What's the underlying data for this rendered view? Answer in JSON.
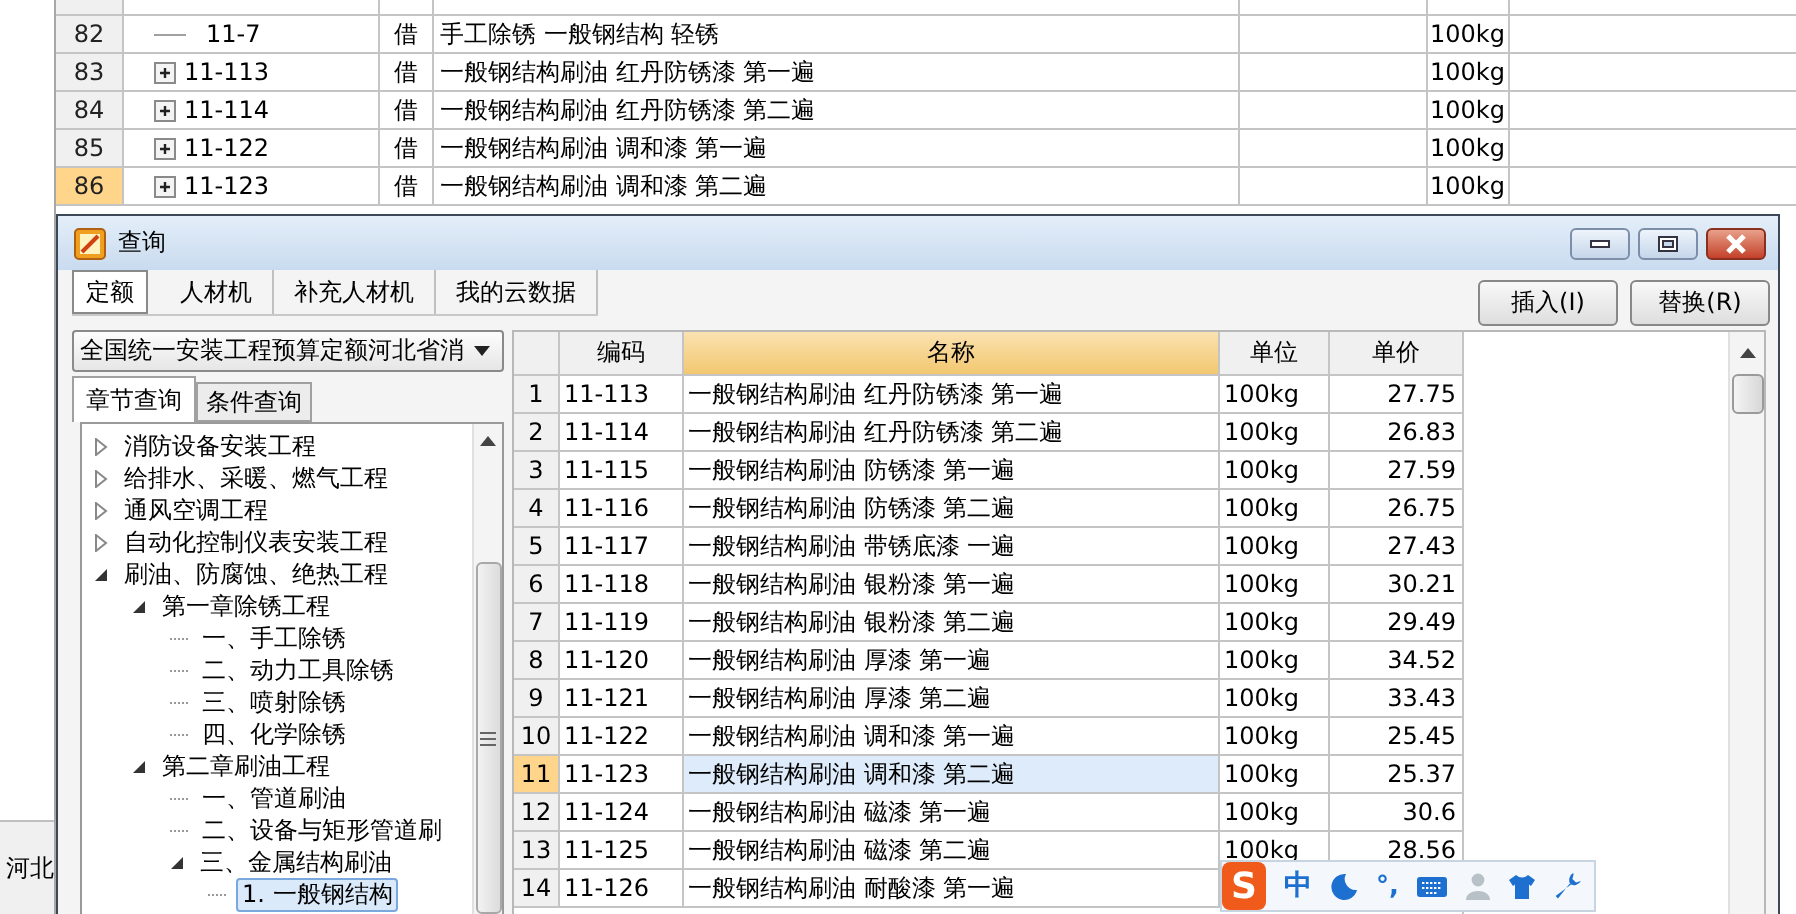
{
  "sheet": {
    "rows": [
      {
        "number": "82",
        "expandable": false,
        "code": "11-7",
        "type": "借",
        "name": "手工除锈 一般钢结构 轻锈",
        "unit": "100kg",
        "selected": false
      },
      {
        "number": "83",
        "expandable": true,
        "code": "11-113",
        "type": "借",
        "name": "一般钢结构刷油 红丹防锈漆 第一遍",
        "unit": "100kg",
        "selected": false
      },
      {
        "number": "84",
        "expandable": true,
        "code": "11-114",
        "type": "借",
        "name": "一般钢结构刷油 红丹防锈漆 第二遍",
        "unit": "100kg",
        "selected": false
      },
      {
        "number": "85",
        "expandable": true,
        "code": "11-122",
        "type": "借",
        "name": "一般钢结构刷油 调和漆 第一遍",
        "unit": "100kg",
        "selected": false
      },
      {
        "number": "86",
        "expandable": true,
        "code": "11-123",
        "type": "借",
        "name": "一般钢结构刷油 调和漆 第二遍",
        "unit": "100kg",
        "selected": true
      }
    ]
  },
  "side_panel": {
    "text": "河北"
  },
  "dialog": {
    "title": "查询",
    "tabs": [
      {
        "label": "定额",
        "selected": true
      },
      {
        "label": "人材机",
        "selected": false
      },
      {
        "label": "补充人材机",
        "selected": false
      },
      {
        "label": "我的云数据",
        "selected": false
      }
    ],
    "buttons": [
      "插入(I)",
      "替换(R)"
    ],
    "library": "全国统一安装工程预算定额河北省消",
    "search_tabs": [
      {
        "label": "章节查询",
        "selected": true
      },
      {
        "label": "条件查询",
        "selected": false
      }
    ],
    "tree": [
      {
        "label": "消防设备安装工程",
        "expanded": false,
        "selected": false
      },
      {
        "label": "给排水、采暖、燃气工程",
        "expanded": false,
        "selected": false
      },
      {
        "label": "通风空调工程",
        "expanded": false,
        "selected": false
      },
      {
        "label": "自动化控制仪表安装工程",
        "expanded": false,
        "selected": false
      },
      {
        "label": "刷油、防腐蚀、绝热工程",
        "expanded": true,
        "selected": false,
        "children": [
          {
            "label": "第一章除锈工程",
            "expanded": true,
            "selected": false,
            "children": [
              {
                "label": "一、手工除锈",
                "selected": false
              },
              {
                "label": "二、动力工具除锈",
                "selected": false
              },
              {
                "label": "三、喷射除锈",
                "selected": false
              },
              {
                "label": "四、化学除锈",
                "selected": false
              }
            ]
          },
          {
            "label": "第二章刷油工程",
            "expanded": true,
            "selected": false,
            "children": [
              {
                "label": "一、管道刷油",
                "selected": false
              },
              {
                "label": "二、设备与矩形管道刷",
                "selected": false
              },
              {
                "label": "三、金属结构刷油",
                "expanded": true,
                "selected": false,
                "children": [
                  {
                    "label": "1. 一般钢结构",
                    "selected": true
                  }
                ]
              }
            ]
          }
        ]
      }
    ],
    "table": {
      "columns": [
        {
          "label": "编码",
          "sorted": false
        },
        {
          "label": "名称",
          "sorted": true
        },
        {
          "label": "单位",
          "sorted": false
        },
        {
          "label": "单价",
          "sorted": false
        }
      ],
      "rows": [
        {
          "number": "1",
          "code": "11-113",
          "name": "一般钢结构刷油 红丹防锈漆 第一遍",
          "unit": "100kg",
          "price": "27.75",
          "selected": false
        },
        {
          "number": "2",
          "code": "11-114",
          "name": "一般钢结构刷油 红丹防锈漆 第二遍",
          "unit": "100kg",
          "price": "26.83",
          "selected": false
        },
        {
          "number": "3",
          "code": "11-115",
          "name": "一般钢结构刷油 防锈漆 第一遍",
          "unit": "100kg",
          "price": "27.59",
          "selected": false
        },
        {
          "number": "4",
          "code": "11-116",
          "name": "一般钢结构刷油 防锈漆 第二遍",
          "unit": "100kg",
          "price": "26.75",
          "selected": false
        },
        {
          "number": "5",
          "code": "11-117",
          "name": "一般钢结构刷油 带锈底漆 一遍",
          "unit": "100kg",
          "price": "27.43",
          "selected": false
        },
        {
          "number": "6",
          "code": "11-118",
          "name": "一般钢结构刷油 银粉漆 第一遍",
          "unit": "100kg",
          "price": "30.21",
          "selected": false
        },
        {
          "number": "7",
          "code": "11-119",
          "name": "一般钢结构刷油 银粉漆 第二遍",
          "unit": "100kg",
          "price": "29.49",
          "selected": false
        },
        {
          "number": "8",
          "code": "11-120",
          "name": "一般钢结构刷油 厚漆 第一遍",
          "unit": "100kg",
          "price": "34.52",
          "selected": false
        },
        {
          "number": "9",
          "code": "11-121",
          "name": "一般钢结构刷油 厚漆 第二遍",
          "unit": "100kg",
          "price": "33.43",
          "selected": false
        },
        {
          "number": "10",
          "code": "11-122",
          "name": "一般钢结构刷油 调和漆 第一遍",
          "unit": "100kg",
          "price": "25.45",
          "selected": false
        },
        {
          "number": "11",
          "code": "11-123",
          "name": "一般钢结构刷油 调和漆 第二遍",
          "unit": "100kg",
          "price": "25.37",
          "selected": true
        },
        {
          "number": "12",
          "code": "11-124",
          "name": "一般钢结构刷油 磁漆 第一遍",
          "unit": "100kg",
          "price": "30.6",
          "selected": false
        },
        {
          "number": "13",
          "code": "11-125",
          "name": "一般钢结构刷油 磁漆 第二遍",
          "unit": "100kg",
          "price": "28.56",
          "selected": false
        },
        {
          "number": "14",
          "code": "11-126",
          "name": "一般钢结构刷油 耐酸漆 第一遍",
          "selected": false
        }
      ]
    }
  },
  "ime_toolbar": {
    "logo": "S",
    "mode": "中",
    "punctuation": "°,"
  }
}
